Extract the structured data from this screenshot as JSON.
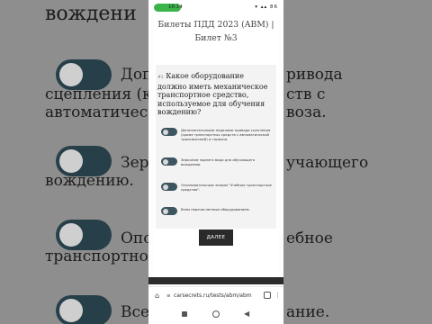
{
  "background": {
    "lines": [
      "вождени",
      "Доп",
      "ривода",
      "сцепления (кр",
      "ств с",
      "автоматическ",
      "воза.",
      "Зер",
      "учающего",
      "вождению.",
      "Опо",
      "ебное",
      "транспортное",
      "Все",
      "ание."
    ]
  },
  "status_bar": {
    "call_time": "16:14",
    "icons": "▾ ▴▴ 86"
  },
  "page": {
    "title": "Билеты ПДД 2023 (ABM) | Билет №3",
    "question_number": "#3",
    "question": "Какое оборудование должно иметь механическое транспортное средство, используемое для обучения вождению?",
    "options": [
      "Дополнительными педалями привода сцепления (кроме транспортных средств с автоматической трансмиссией) и тормоза.",
      "Зеркалом заднего вида для обучающего вождению.",
      "Опознавательным знаком \"Учебное транспортное средство\".",
      "Всем перечисленным оборудованием."
    ],
    "next_label": "ДАЛЕЕ"
  },
  "browser": {
    "home_icon": "⌂",
    "url": "carsecrets.ru/tests/abm/abm",
    "menu_icon": "⋮"
  },
  "nav": {
    "back_icon": "◀"
  }
}
